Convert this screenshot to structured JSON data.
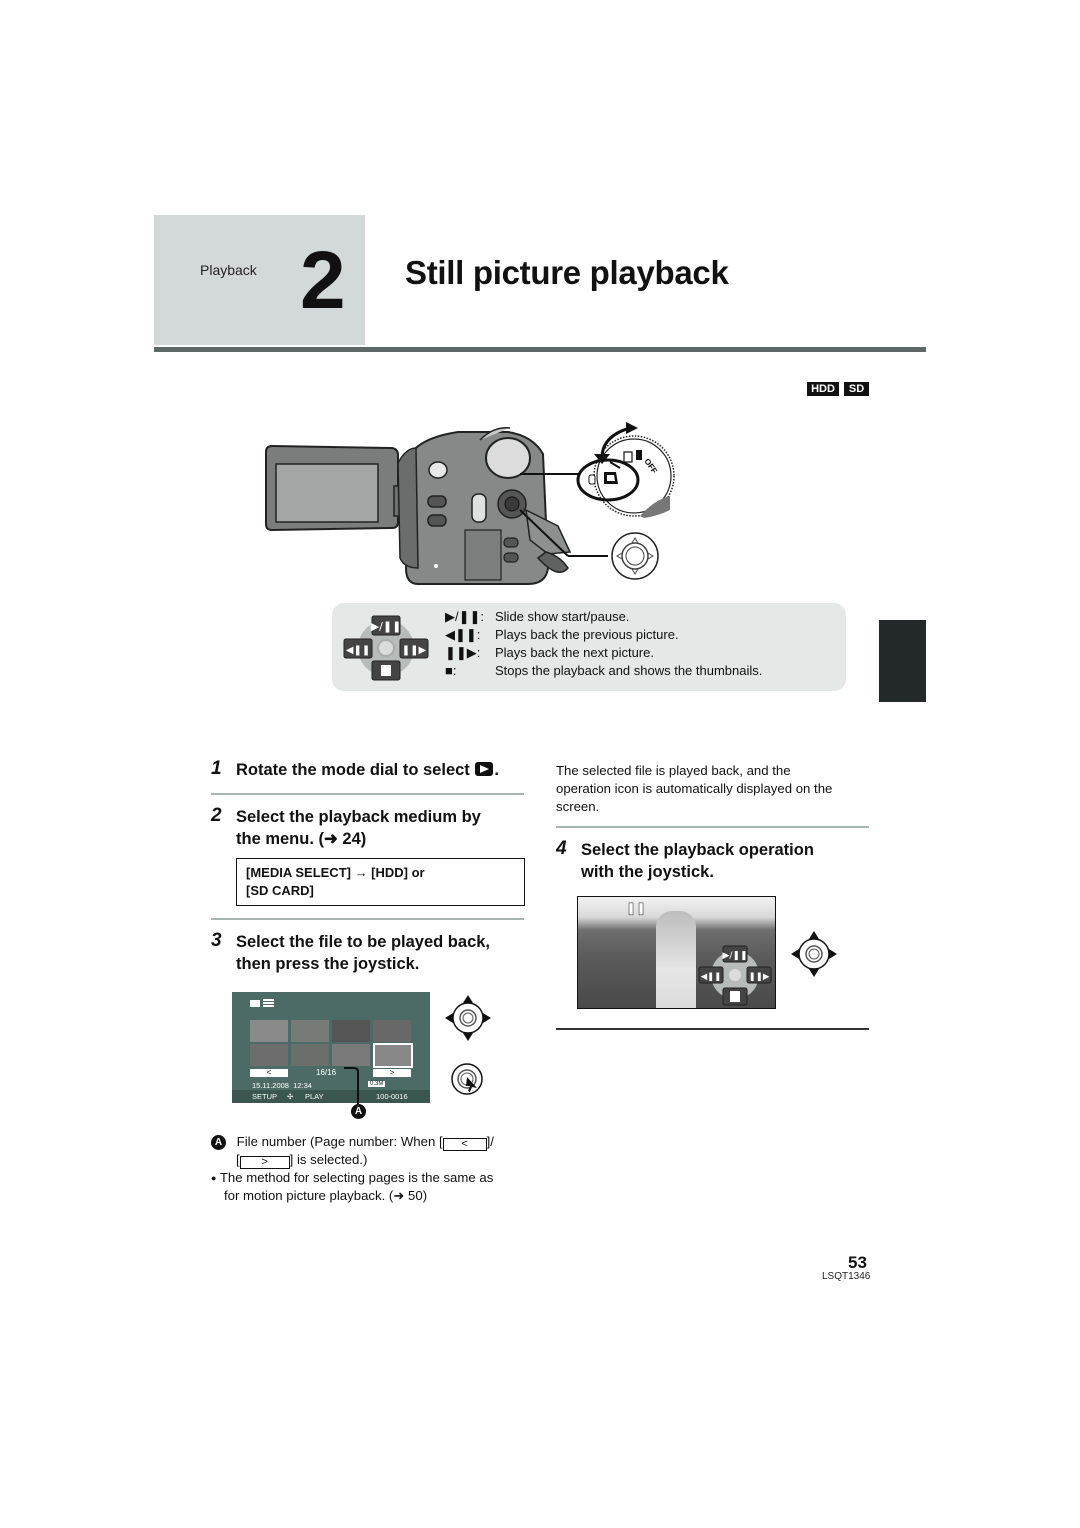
{
  "header": {
    "section": "Playback",
    "number": "2",
    "title": "Still picture playback"
  },
  "media_badges": [
    "HDD",
    "SD"
  ],
  "colors": {
    "header_box": "#d3d9d8",
    "header_rule": "#5e6866",
    "panel_bg": "#e4e8e7",
    "side_tab": "#232928",
    "lcd_bg": "#4c6a66"
  },
  "camera_figure": {
    "mode_dial_labels": [
      "OFF"
    ],
    "icons": [
      "camcorder-icon",
      "mode-dial-icon",
      "joystick-icon",
      "rotate-arrow-icon"
    ]
  },
  "operations": [
    {
      "symbol": "▶/❚❚:",
      "icon": "play-pause-icon",
      "text": "Slide show start/pause."
    },
    {
      "symbol": "◀❚❚:",
      "icon": "previous-icon",
      "text": "Plays back the previous picture."
    },
    {
      "symbol": "❚❚▶:",
      "icon": "next-icon",
      "text": "Plays back the next picture."
    },
    {
      "symbol": "■:",
      "icon": "stop-icon",
      "text": "Stops the playback and shows the thumbnails."
    }
  ],
  "steps": [
    {
      "num": "1",
      "text": "Rotate the mode dial to select",
      "suffix": "."
    },
    {
      "num": "2",
      "text_line1": "Select the playback medium by",
      "text_line2": "the menu. (➜ 24)"
    },
    {
      "num": "3",
      "text_line1": "Select the file to be played back,",
      "text_line2": "then press the joystick."
    },
    {
      "num": "4",
      "text_line1": "Select the playback operation",
      "text_line2": "with the joystick."
    }
  ],
  "media_select": {
    "line1": "[MEDIA SELECT] → [HDD] or",
    "line2": "[SD CARD]"
  },
  "lcd_screen": {
    "page_prev": "<",
    "page_next": ">",
    "counter": "16/16",
    "datetime": "15.11.2008  12:34",
    "resolution": "0.3M",
    "setup_label": "SETUP",
    "play_label": "PLAY",
    "file_number": "100-0016",
    "callout": "A"
  },
  "notes": {
    "callout": "A",
    "file_number_pre": "File number (Page number: When [",
    "btn_prev": "<",
    "file_number_mid": "]/",
    "btn_next": ">",
    "file_number_post": "] is selected.)",
    "bullet": "●",
    "bullet_text_line1": "The method for selecting pages is the same as",
    "bullet_text_line2": "for motion picture playback. (➜ 50)"
  },
  "right_text": {
    "line1": "The selected file is played back, and the",
    "line2": "operation icon is automatically displayed on the",
    "line3": "screen."
  },
  "playback_screen": {
    "pause_indicator": "❚❚",
    "btn_play_pause": "▶/❚❚",
    "btn_prev": "◀❚❚",
    "btn_next": "❚❚▶",
    "btn_stop": "■"
  },
  "footer": {
    "page_number": "53",
    "model_code": "LSQT1346"
  }
}
